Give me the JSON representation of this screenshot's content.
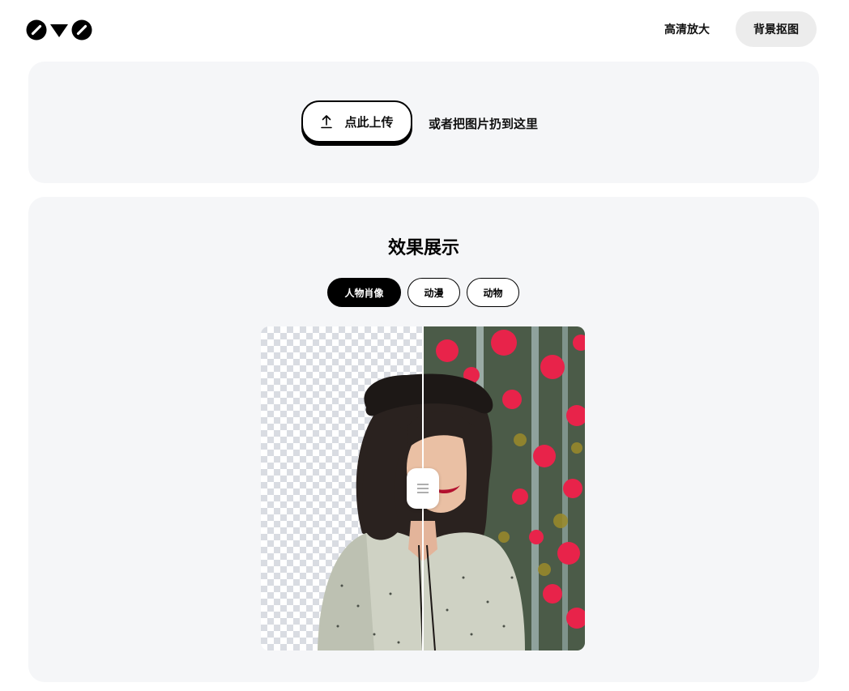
{
  "header": {
    "logo_icon": "logo-mark-icon",
    "nav": [
      {
        "label": "高清放大"
      },
      {
        "label": "背景抠图"
      }
    ]
  },
  "upload": {
    "button_label": "点此上传",
    "button_icon": "upload-arrow-icon",
    "drop_hint": "或者把图片扔到这里"
  },
  "demo": {
    "title": "效果展示",
    "tabs": [
      {
        "label": "人物肖像",
        "active": true
      },
      {
        "label": "动漫",
        "active": false
      },
      {
        "label": "动物",
        "active": false
      }
    ],
    "compare_handle_icon": "drag-handle-icon",
    "split_fraction": 0.5
  },
  "colors": {
    "card_bg": "#f5f6f8",
    "active_tab_bg": "#000000",
    "nav_active_bg": "#ececec",
    "flowers": "#e8234a"
  }
}
